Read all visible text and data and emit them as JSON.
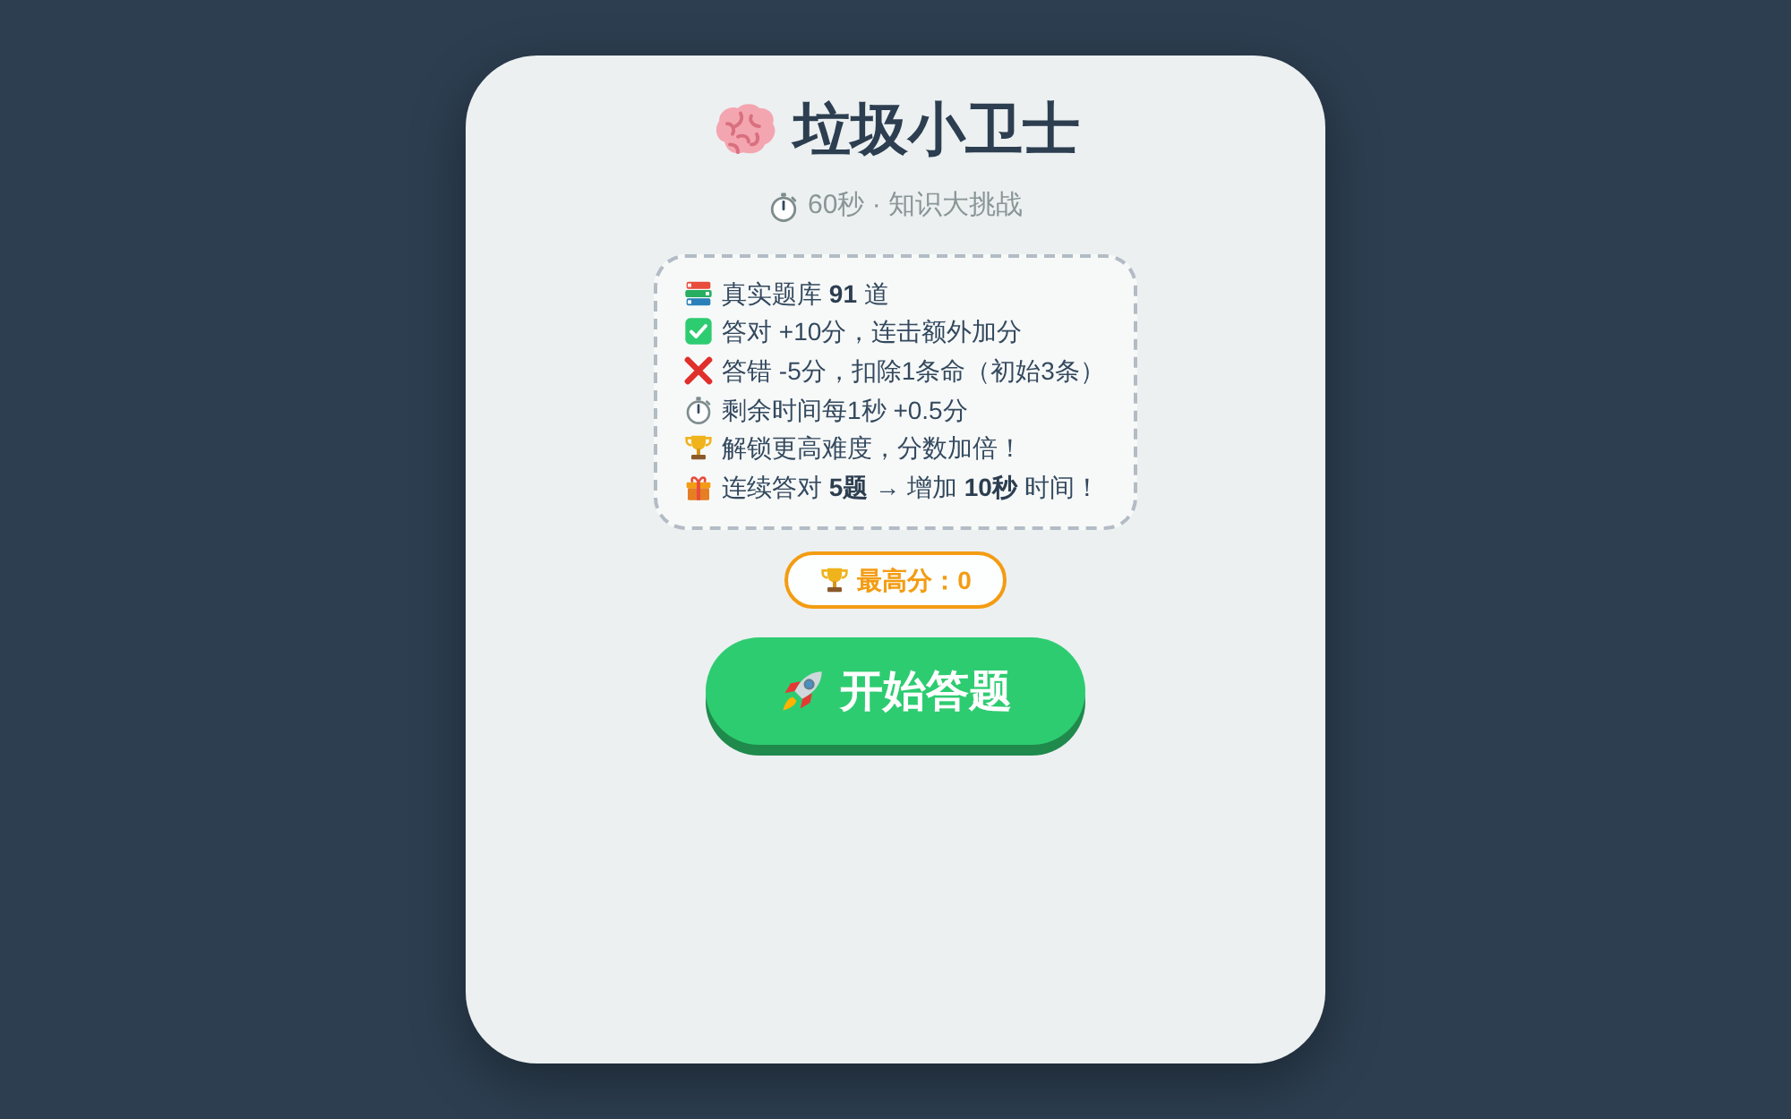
{
  "header": {
    "title": "垃圾小卫士",
    "subtitle": "60秒 · 知识大挑战"
  },
  "rules": [
    {
      "kind": "books",
      "text": "真实题库 **91** 道"
    },
    {
      "kind": "check",
      "text": "答对 +10分，连击额外加分"
    },
    {
      "kind": "cross",
      "text": "答错 -5分，扣除1条命（初始3条）"
    },
    {
      "kind": "stopwatch",
      "text": "剩余时间每1秒 +0.5分"
    },
    {
      "kind": "trophy",
      "text": "解锁更高难度，分数加倍！"
    },
    {
      "kind": "gift",
      "text": "连续答对 **5题** → 增加 **10秒** 时间！"
    }
  ],
  "best_score": "最高分：0",
  "start_button": "开始答题"
}
